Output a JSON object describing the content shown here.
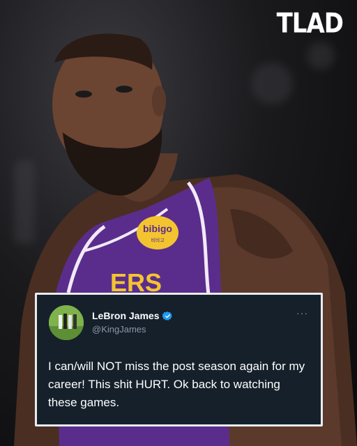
{
  "watermark": {
    "text": "TLAD"
  },
  "photo": {
    "jersey_sponsor": "bibigo",
    "jersey_sponsor_sub": "비비고",
    "jersey_text": "ERS"
  },
  "tweet": {
    "display_name": "LeBron James",
    "handle": "@KingJames",
    "more_icon": "ellipsis-icon",
    "verified_icon": "verified-badge-icon",
    "text": "I can/will NOT miss the post season again for my career! This shit HURT. Ok back to watching these games."
  },
  "colors": {
    "card_bg": "#15202b",
    "card_border": "#e9ecef",
    "verified": "#1d9bf0",
    "handle": "#8b98a5",
    "jersey": "#5a2d8c"
  }
}
